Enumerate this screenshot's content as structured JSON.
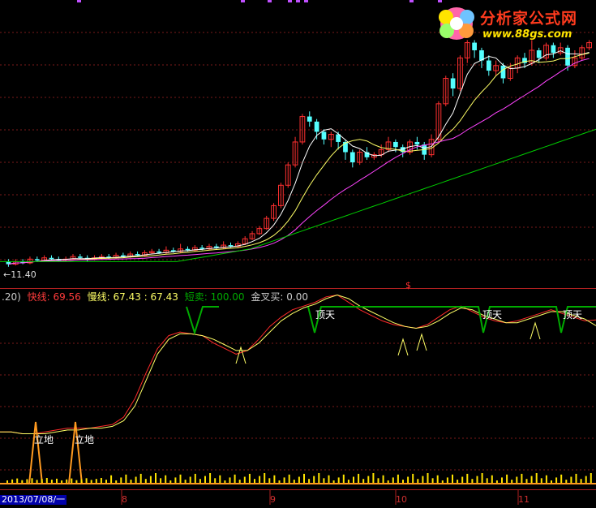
{
  "watermark": {
    "brand": "分析家公式网",
    "url": "www.88gs.com",
    "colors": {
      "brand": "#ff3b1e",
      "url": "#ffe400"
    }
  },
  "price_panel": {
    "low_marker": "11.40"
  },
  "indicator_header": {
    "prefix": ".20)",
    "fast": "快线: 69.56",
    "slow": "慢线: 67.43 : 67.43",
    "short_sell": "短卖: 100.00",
    "golden_cross": "金叉买: 0.00",
    "colors": {
      "fast": "#ff3b3b",
      "slow": "#ffff66",
      "short_sell": "#00aa00",
      "golden_cross": "#cccccc"
    }
  },
  "signal_marker": "$",
  "annotations": {
    "top": "顶天",
    "bottom": "立地"
  },
  "x_axis": {
    "start_date": "2013/07/08/一",
    "ticks": [
      "8",
      "9",
      "10",
      "11"
    ]
  },
  "chart_data": [
    {
      "type": "candlestick",
      "title": "",
      "colors": {
        "up": "#ff3030",
        "down": "#54ffff",
        "ma5": "#ffffff",
        "ma10": "#ffff66",
        "ma20": "#ff44ff",
        "ma60": "#00cc00"
      },
      "series": [
        {
          "type": "candlestick",
          "values": [
            [
              11.6,
              11.5,
              11.7,
              11.4
            ],
            [
              11.5,
              11.6,
              11.7,
              11.45
            ],
            [
              11.6,
              11.55,
              11.7,
              11.5
            ],
            [
              11.55,
              11.7,
              11.8,
              11.5
            ],
            [
              11.7,
              11.65,
              11.8,
              11.6
            ],
            [
              11.65,
              11.75,
              11.85,
              11.6
            ],
            [
              11.75,
              11.7,
              11.85,
              11.65
            ],
            [
              11.7,
              11.65,
              11.8,
              11.6
            ],
            [
              11.65,
              11.7,
              11.8,
              11.6
            ],
            [
              11.7,
              11.8,
              11.9,
              11.65
            ],
            [
              11.8,
              11.75,
              11.9,
              11.7
            ],
            [
              11.75,
              11.7,
              11.85,
              11.6
            ],
            [
              11.7,
              11.75,
              11.85,
              11.65
            ],
            [
              11.75,
              11.8,
              11.9,
              11.7
            ],
            [
              11.8,
              11.75,
              11.9,
              11.7
            ],
            [
              11.75,
              11.85,
              11.95,
              11.7
            ],
            [
              11.85,
              11.8,
              11.95,
              11.75
            ],
            [
              11.8,
              11.9,
              12.0,
              11.75
            ],
            [
              11.9,
              11.85,
              12.0,
              11.8
            ],
            [
              11.85,
              11.95,
              12.05,
              11.8
            ],
            [
              11.95,
              12.0,
              12.1,
              11.9
            ],
            [
              12.0,
              11.95,
              12.1,
              11.9
            ],
            [
              11.95,
              12.05,
              12.2,
              11.9
            ],
            [
              12.05,
              12.0,
              12.15,
              11.95
            ],
            [
              12.0,
              12.1,
              12.3,
              11.95
            ],
            [
              12.1,
              12.05,
              12.2,
              12.0
            ],
            [
              12.05,
              12.15,
              12.25,
              12.0
            ],
            [
              12.15,
              12.1,
              12.25,
              12.05
            ],
            [
              12.1,
              12.2,
              12.3,
              12.05
            ],
            [
              12.2,
              12.15,
              12.3,
              12.1
            ],
            [
              12.15,
              12.25,
              12.4,
              12.1
            ],
            [
              12.25,
              12.2,
              12.35,
              12.15
            ],
            [
              12.2,
              12.3,
              12.4,
              12.15
            ],
            [
              12.3,
              12.5,
              12.6,
              12.25
            ],
            [
              12.5,
              12.7,
              12.8,
              12.45
            ],
            [
              12.7,
              12.9,
              13.0,
              12.65
            ],
            [
              12.9,
              13.3,
              13.4,
              12.85
            ],
            [
              13.3,
              13.8,
              13.9,
              13.2
            ],
            [
              13.8,
              14.6,
              14.7,
              13.7
            ],
            [
              14.6,
              15.4,
              15.5,
              14.5
            ],
            [
              15.4,
              16.3,
              16.5,
              15.3
            ],
            [
              16.3,
              17.3,
              17.4,
              16.2
            ],
            [
              17.3,
              17.1,
              17.5,
              16.9
            ],
            [
              17.1,
              16.7,
              17.2,
              16.4
            ],
            [
              16.7,
              16.4,
              16.8,
              16.2
            ],
            [
              16.4,
              16.6,
              16.7,
              16.1
            ],
            [
              16.6,
              16.3,
              16.7,
              16.0
            ],
            [
              16.3,
              15.9,
              16.4,
              15.6
            ],
            [
              15.9,
              15.5,
              16.0,
              15.3
            ],
            [
              15.5,
              15.9,
              16.0,
              15.4
            ],
            [
              15.9,
              15.7,
              16.1,
              15.6
            ],
            [
              15.7,
              15.8,
              15.9,
              15.6
            ],
            [
              15.8,
              16.0,
              16.2,
              15.7
            ],
            [
              16.0,
              16.3,
              16.5,
              15.9
            ],
            [
              16.3,
              16.1,
              16.4,
              15.9
            ],
            [
              16.1,
              15.9,
              16.2,
              15.7
            ],
            [
              15.9,
              16.3,
              16.4,
              15.8
            ],
            [
              16.3,
              16.2,
              16.5,
              16.0
            ],
            [
              16.2,
              15.8,
              16.3,
              15.6
            ],
            [
              15.8,
              16.4,
              16.6,
              15.7
            ],
            [
              16.4,
              17.8,
              17.9,
              16.3
            ],
            [
              17.8,
              18.8,
              18.9,
              17.7
            ],
            [
              18.8,
              18.4,
              19.0,
              18.1
            ],
            [
              18.4,
              19.6,
              19.7,
              18.3
            ],
            [
              19.6,
              20.2,
              20.3,
              19.4
            ],
            [
              20.2,
              19.9,
              20.3,
              19.6
            ],
            [
              19.9,
              19.5,
              20.0,
              19.2
            ],
            [
              19.5,
              19.1,
              19.7,
              18.9
            ],
            [
              19.1,
              19.3,
              19.5,
              18.9
            ],
            [
              19.3,
              18.8,
              19.4,
              18.6
            ],
            [
              18.8,
              19.2,
              19.4,
              18.7
            ],
            [
              19.2,
              19.6,
              19.7,
              19.0
            ],
            [
              19.6,
              19.4,
              19.8,
              19.2
            ],
            [
              19.4,
              19.9,
              20.3,
              19.3
            ],
            [
              19.9,
              19.6,
              20.0,
              19.4
            ],
            [
              19.6,
              20.1,
              20.2,
              19.5
            ],
            [
              20.1,
              19.8,
              20.2,
              19.6
            ],
            [
              19.8,
              20.0,
              20.2,
              19.7
            ],
            [
              20.0,
              19.3,
              20.1,
              19.1
            ],
            [
              19.3,
              19.6,
              19.9,
              19.2
            ],
            [
              19.6,
              20.0,
              20.1,
              19.5
            ],
            [
              20.0,
              20.2,
              20.3,
              19.9
            ]
          ]
        },
        {
          "name": "",
          "type": "line",
          "values": [
            11.6,
            11.6,
            11.6,
            11.6,
            11.6,
            11.6,
            11.6,
            11.6,
            11.6,
            11.6,
            11.6,
            11.6,
            11.6,
            11.6,
            11.6,
            11.6,
            11.6,
            11.6,
            11.6,
            11.6,
            11.6,
            11.6,
            11.6,
            11.6,
            11.6,
            11.65,
            11.7,
            11.75,
            11.8,
            11.85,
            11.9,
            11.95,
            12.0,
            12.05,
            12.1,
            12.2,
            12.3,
            12.4,
            12.5,
            12.6,
            12.7,
            12.8,
            12.9,
            13.0,
            13.1,
            13.2,
            13.3,
            13.4,
            13.5,
            13.6,
            13.7,
            13.8,
            13.9,
            14.0,
            14.1,
            14.2,
            14.3,
            14.4,
            14.5,
            14.6,
            14.7,
            14.8,
            14.9,
            15.0,
            15.1,
            15.2,
            15.3,
            15.4,
            15.5,
            15.6,
            15.7,
            15.8,
            15.9,
            16.0,
            16.1,
            16.2,
            16.3,
            16.4,
            16.5,
            16.6,
            16.7,
            16.8
          ]
        }
      ]
    },
    {
      "type": "line",
      "series": [
        {
          "name": "快线",
          "values": [
            10,
            10,
            9,
            9,
            10,
            11,
            12,
            12,
            12,
            13,
            14,
            18,
            28,
            42,
            55,
            62,
            64,
            63,
            62,
            58,
            55,
            52,
            54,
            60,
            67,
            72,
            76,
            78,
            80,
            83,
            84,
            80,
            76,
            73,
            70,
            68,
            67,
            66,
            68,
            72,
            76,
            78,
            75,
            72,
            70,
            69,
            70,
            72,
            74,
            76,
            74,
            72,
            70,
            70.5
          ]
        },
        {
          "name": "慢线",
          "values": [
            10,
            10,
            9,
            9,
            9,
            10,
            11,
            11,
            12,
            12,
            13,
            16,
            24,
            38,
            52,
            60,
            63,
            63,
            62,
            60,
            57,
            54,
            54,
            58,
            64,
            70,
            74,
            77,
            79,
            82,
            84,
            82,
            78,
            75,
            72,
            69,
            67,
            66,
            67,
            70,
            74,
            77,
            76,
            73,
            71,
            69,
            69,
            71,
            73,
            75,
            75,
            73,
            71,
            67.43
          ]
        }
      ]
    }
  ]
}
